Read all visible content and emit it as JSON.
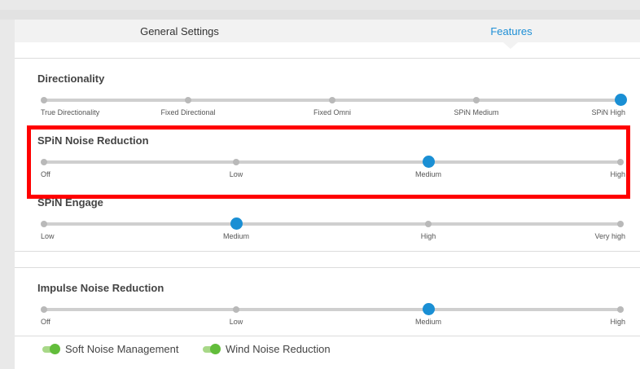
{
  "tabs": {
    "general_label": "General Settings",
    "features_label": "Features",
    "active": "Features"
  },
  "sections": {
    "directionality": {
      "title": "Directionality",
      "stops": [
        "True Directionality",
        "Fixed Directional",
        "Fixed Omni",
        "SPiN Medium",
        "SPiN High"
      ],
      "selected": "SPiN High"
    },
    "spin_noise_reduction": {
      "title": "SPiN Noise Reduction",
      "stops": [
        "Off",
        "Low",
        "Medium",
        "High"
      ],
      "selected": "Medium"
    },
    "spin_engage": {
      "title": "SPiN Engage",
      "stops": [
        "Low",
        "Medium",
        "High",
        "Very high"
      ],
      "selected": "Medium"
    },
    "impulse_noise_reduction": {
      "title": "Impulse Noise Reduction",
      "stops": [
        "Off",
        "Low",
        "Medium",
        "High"
      ],
      "selected": "Medium"
    }
  },
  "toggles": {
    "soft_noise": {
      "label": "Soft Noise Management",
      "on": true
    },
    "wind_noise": {
      "label": "Wind Noise Reduction",
      "on": true
    }
  },
  "colors": {
    "accent": "#1a8fd4",
    "toggle_on": "#62bd3b",
    "highlight": "#ff0000"
  }
}
